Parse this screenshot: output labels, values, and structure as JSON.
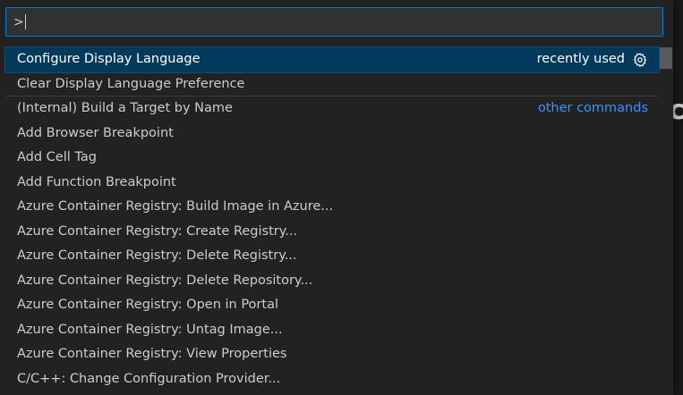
{
  "input": {
    "value": ">"
  },
  "items": [
    {
      "label": "Configure Display Language",
      "desc": "recently used",
      "desc_style": "plain",
      "gear": true,
      "selected": true,
      "separator": false
    },
    {
      "label": "Clear Display Language Preference",
      "desc": "",
      "desc_style": "plain",
      "gear": false,
      "selected": false,
      "separator": true
    },
    {
      "label": "(Internal) Build a Target by Name",
      "desc": "other commands",
      "desc_style": "link",
      "gear": false,
      "selected": false,
      "separator": false
    },
    {
      "label": "Add Browser Breakpoint",
      "desc": "",
      "desc_style": "plain",
      "gear": false,
      "selected": false,
      "separator": false
    },
    {
      "label": "Add Cell Tag",
      "desc": "",
      "desc_style": "plain",
      "gear": false,
      "selected": false,
      "separator": false
    },
    {
      "label": "Add Function Breakpoint",
      "desc": "",
      "desc_style": "plain",
      "gear": false,
      "selected": false,
      "separator": false
    },
    {
      "label": "Azure Container Registry: Build Image in Azure...",
      "desc": "",
      "desc_style": "plain",
      "gear": false,
      "selected": false,
      "separator": false
    },
    {
      "label": "Azure Container Registry: Create Registry...",
      "desc": "",
      "desc_style": "plain",
      "gear": false,
      "selected": false,
      "separator": false
    },
    {
      "label": "Azure Container Registry: Delete Registry...",
      "desc": "",
      "desc_style": "plain",
      "gear": false,
      "selected": false,
      "separator": false
    },
    {
      "label": "Azure Container Registry: Delete Repository...",
      "desc": "",
      "desc_style": "plain",
      "gear": false,
      "selected": false,
      "separator": false
    },
    {
      "label": "Azure Container Registry: Open in Portal",
      "desc": "",
      "desc_style": "plain",
      "gear": false,
      "selected": false,
      "separator": false
    },
    {
      "label": "Azure Container Registry: Untag Image...",
      "desc": "",
      "desc_style": "plain",
      "gear": false,
      "selected": false,
      "separator": false
    },
    {
      "label": "Azure Container Registry: View Properties",
      "desc": "",
      "desc_style": "plain",
      "gear": false,
      "selected": false,
      "separator": false
    },
    {
      "label": "C/C++: Change Configuration Provider...",
      "desc": "",
      "desc_style": "plain",
      "gear": false,
      "selected": false,
      "separator": false
    }
  ],
  "icons": {
    "row_action": "gear-icon"
  },
  "colors": {
    "accent_border": "#0078d4",
    "selection": "#04395e",
    "link": "#3794ff",
    "background": "#222222"
  }
}
